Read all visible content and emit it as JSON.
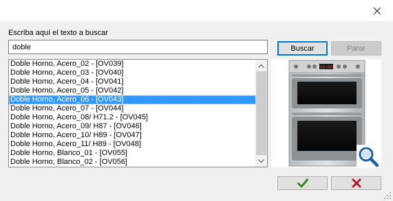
{
  "search": {
    "label": "Escriba aquí el texto a buscar",
    "value": "doble"
  },
  "buttons": {
    "search": "Buscar",
    "stop": "Parar"
  },
  "results": [
    "Doble Horno, Acero_02 - [OV039]",
    "Doble Horno, Acero_03 - [OV040]",
    "Doble Horno, Acero_04 - [OV041]",
    "Doble Horno, Acero_05 - [OV042]",
    "Doble Horno, Acero_06 - [OV043]",
    "Doble Horno, Acero_07 - [OV044]",
    "Doble Horno, Acero_08/ H71.2 - [OV045]",
    "Doble Horno, Acero_09/ H87 - [OV046]",
    "Doble Horno, Acero_10/ H89 - [OV047]",
    "Doble Horno, Acero_11/ H89 - [OV048]",
    "Doble Horno, Blanco_01 - [OV055]",
    "Doble Horno, Blanco_02 - [OV056]"
  ],
  "selected_index": 4,
  "preview": {
    "display_text": "12:00"
  },
  "icons": {
    "close": "close-icon",
    "zoom": "magnifier-icon",
    "ok": "checkmark-icon",
    "cancel": "x-mark-icon"
  },
  "colors": {
    "selection": "#3399ff",
    "focus_border": "#0078d7",
    "ok_green": "#2e8b1e",
    "cancel_red": "#b0182a",
    "zoom_blue": "#1f5fa8"
  }
}
